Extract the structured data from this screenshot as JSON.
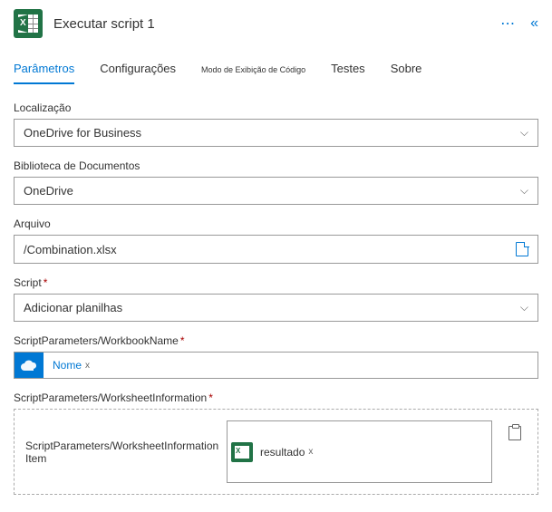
{
  "header": {
    "title": "Executar script 1"
  },
  "tabs": {
    "parametros": "Parâmetros",
    "configuracoes": "Configurações",
    "code_view": "Modo de Exibição de Código",
    "testes": "Testes",
    "sobre": "Sobre"
  },
  "fields": {
    "localizacao": {
      "label": "Localização",
      "value": "OneDrive for Business"
    },
    "biblioteca": {
      "label": "Biblioteca de Documentos",
      "value": "OneDrive"
    },
    "arquivo": {
      "label": "Arquivo",
      "value": "/Combination.xlsx"
    },
    "script": {
      "label": "Script",
      "value": "Adicionar planilhas"
    },
    "workbook_name": {
      "label": "ScriptParameters/WorkbookName",
      "chip": "Nome",
      "chip_close": "x"
    },
    "worksheet_info": {
      "label": "ScriptParameters/WorksheetInformation",
      "item_label": "ScriptParameters/WorksheetInformation Item",
      "chip": "resultado",
      "chip_close": "x"
    }
  }
}
